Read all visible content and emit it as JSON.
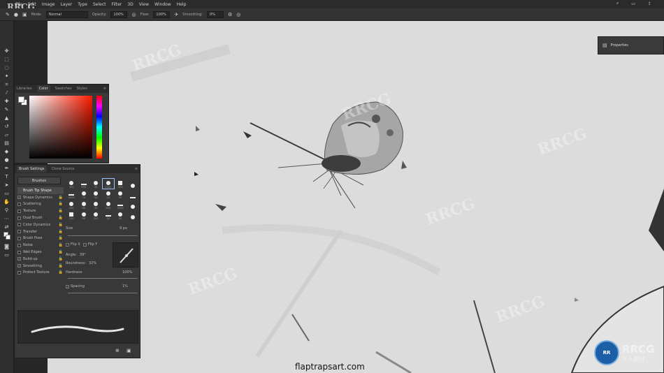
{
  "app": {
    "logo_text": "RRCG"
  },
  "menu": [
    "File",
    "Edit",
    "Image",
    "Layer",
    "Type",
    "Select",
    "Filter",
    "3D",
    "View",
    "Window",
    "Help"
  ],
  "options_bar": {
    "mode_label": "Mode:",
    "mode_value": "Normal",
    "opacity_label": "Opacity:",
    "opacity_value": "100%",
    "flow_label": "Flow:",
    "flow_value": "100%",
    "smoothing_label": "Smoothing:",
    "smoothing_value": "0%"
  },
  "color_panel": {
    "tabs": [
      "Libraries",
      "Color",
      "Swatches",
      "Styles"
    ],
    "active_tab": "Color",
    "foreground": "#ffffff",
    "background": "#ffffff"
  },
  "brush_panel": {
    "tabs": [
      "Brush Settings",
      "Clone Source"
    ],
    "brushes_button": "Brushes",
    "options": [
      {
        "label": "Brush Tip Shape",
        "checked": null,
        "selected": true
      },
      {
        "label": "Shape Dynamics",
        "checked": true
      },
      {
        "label": "Scattering",
        "checked": false
      },
      {
        "label": "Texture",
        "checked": false
      },
      {
        "label": "Dual Brush",
        "checked": false
      },
      {
        "label": "Color Dynamics",
        "checked": false
      },
      {
        "label": "Transfer",
        "checked": false
      },
      {
        "label": "Brush Pose",
        "checked": false
      },
      {
        "label": "Noise",
        "checked": false
      },
      {
        "label": "Wet Edges",
        "checked": false
      },
      {
        "label": "Build-up",
        "checked": true
      },
      {
        "label": "Smoothing",
        "checked": true
      },
      {
        "label": "Protect Texture",
        "checked": false
      }
    ],
    "tip_sizes": [
      "300",
      "900",
      "30",
      "1500",
      "300",
      "",
      "2500",
      "70",
      "50",
      "15",
      "50",
      "",
      "100",
      "60",
      "30",
      "500",
      "1000",
      "",
      "100",
      "60",
      "200",
      "50",
      "50",
      ""
    ],
    "size_label": "Size",
    "size_value": "9 px",
    "flip_x": "Flip X",
    "flip_y": "Flip Y",
    "angle_label": "Angle:",
    "angle_value": "39°",
    "roundness_label": "Roundness:",
    "roundness_value": "32%",
    "hardness_label": "Hardness",
    "hardness_value": "100%",
    "spacing_label": "Spacing",
    "spacing_value": "1%"
  },
  "properties_panel": {
    "title": "Properties"
  },
  "footer": {
    "site": "flaptrapsart.com",
    "brand_top": "RRCG",
    "brand_bottom": "人人素材"
  },
  "watermark_text": "RRCG"
}
